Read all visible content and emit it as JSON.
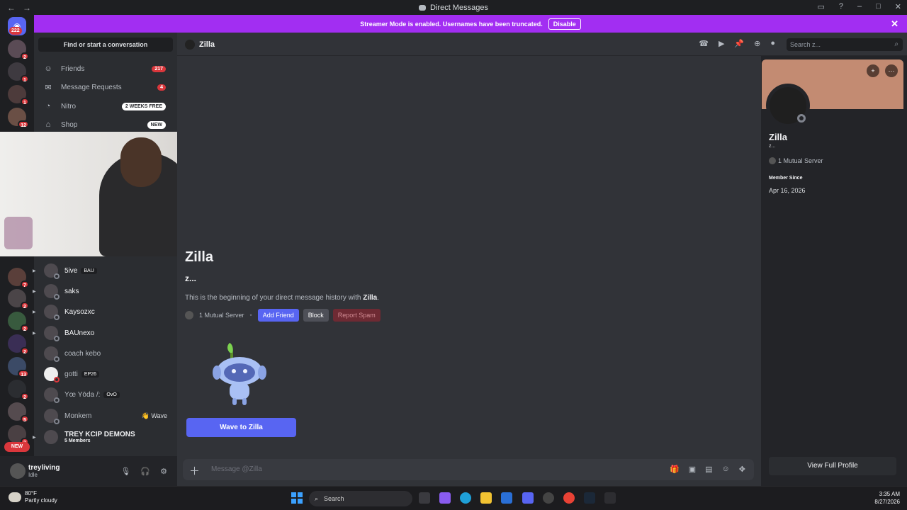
{
  "window": {
    "title": "Direct Messages"
  },
  "banner": {
    "text": "Streamer Mode is enabled. Usernames have been truncated.",
    "disable_label": "Disable"
  },
  "guilds": {
    "dm_badge": "222",
    "badges": [
      "2",
      "1",
      "1",
      "12",
      "7",
      "2",
      "2",
      "2",
      "13",
      "2",
      "5",
      "2"
    ],
    "new_label": "NEW"
  },
  "sidebar": {
    "find_label": "Find or start a conversation",
    "nav": [
      {
        "label": "Friends",
        "count": "217",
        "icon": "friends-icon"
      },
      {
        "label": "Message Requests",
        "count": "4",
        "icon": "envelope-icon"
      },
      {
        "label": "Nitro",
        "pill": "2 WEEKS FREE",
        "icon": "nitro-icon"
      },
      {
        "label": "Shop",
        "pill": "NEW",
        "icon": "shop-icon"
      }
    ],
    "dms": [
      {
        "name": "5ive",
        "tag": "BAU"
      },
      {
        "name": "saks"
      },
      {
        "name": "Kaysozxc"
      },
      {
        "name": "BAUnexo"
      },
      {
        "name": "coach kebo"
      },
      {
        "name": "gotti",
        "tag": "EP26"
      },
      {
        "name": "Yœ Yōda /:",
        "tag": "OvO"
      },
      {
        "name": "Monkem",
        "wave": "Wave"
      },
      {
        "name": "TREY KCIP DEMONS",
        "sub": "5 Members"
      }
    ]
  },
  "user": {
    "name": "treyliving",
    "status": "Idle"
  },
  "chat": {
    "header_name": "Zilla",
    "search_placeholder": "Search z...",
    "title": "Zilla",
    "subtitle": "z...",
    "begin_prefix": "This is the beginning of your direct message history with ",
    "begin_name": "Zilla",
    "begin_suffix": ".",
    "mutual": "1 Mutual Server",
    "add_friend": "Add Friend",
    "block": "Block",
    "report": "Report Spam",
    "wave_button": "Wave to Zilla",
    "composer_placeholder": "Message @Zilla"
  },
  "profile": {
    "name": "Zilla",
    "handle": "z...",
    "mutual": "1 Mutual Server",
    "member_since_label": "Member Since",
    "member_since": "Apr 16, 2026",
    "view_full": "View Full Profile"
  },
  "taskbar": {
    "temp": "80°F",
    "weather": "Partly cloudy",
    "search": "Search",
    "time": "3:35 AM",
    "date": "8/27/2026"
  },
  "colors": {
    "accent": "#5865f2",
    "banner": "#a22ef2",
    "danger": "#da373c"
  }
}
